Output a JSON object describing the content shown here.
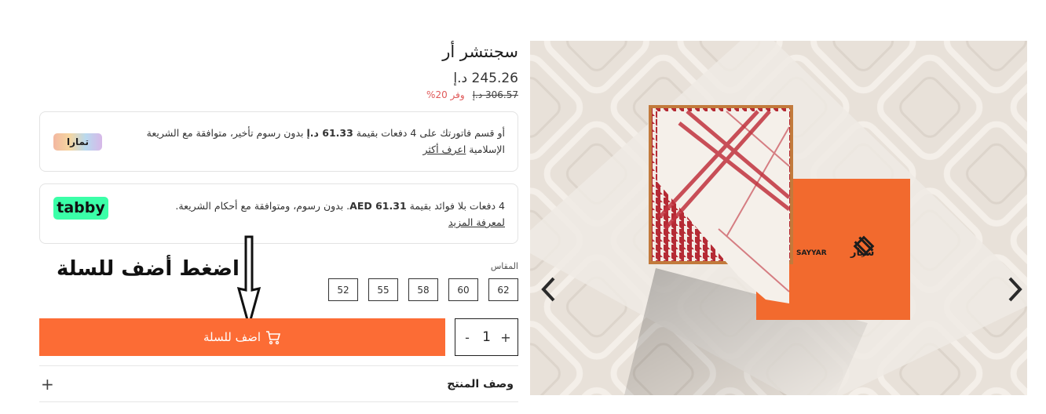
{
  "product": {
    "title": "سجنتشر أر",
    "price": "245.26 د.إ",
    "old_price": "306.57 د.إ",
    "save": "وفر 20%"
  },
  "tamara": {
    "text_before": "أو قسم فاتورتك على 4 دفعات بقيمة ",
    "amount": "61.33 د.إ",
    "text_after": " بدون رسوم تأخير، متوافقة مع الشريعة الإسلامية ",
    "link": "اعرف أكثر",
    "logo": "تمارا"
  },
  "tabby": {
    "text_before": "4 دفعات بلا فوائد بقيمة ",
    "amount": "AED 61.31",
    "text_after": ". بدون رسوم، ومتوافقة مع أحكام الشريعة.",
    "link": "لمعرفة المزيد",
    "logo": "tabby"
  },
  "size": {
    "label": "المقاس",
    "options": [
      "62",
      "60",
      "58",
      "55",
      "52"
    ]
  },
  "annotation": "اضغط أضف للسلة",
  "cart": {
    "add_label": "اضف للسلة",
    "quantity": "1",
    "minus": "-",
    "plus": "+"
  },
  "description": {
    "label": "وصف المنتج",
    "toggle": "+"
  },
  "image": {
    "brand_ar": "سيار",
    "brand_en": "SAYYAR",
    "box_color": "#f26a2e",
    "accent": "#fc6c35"
  }
}
